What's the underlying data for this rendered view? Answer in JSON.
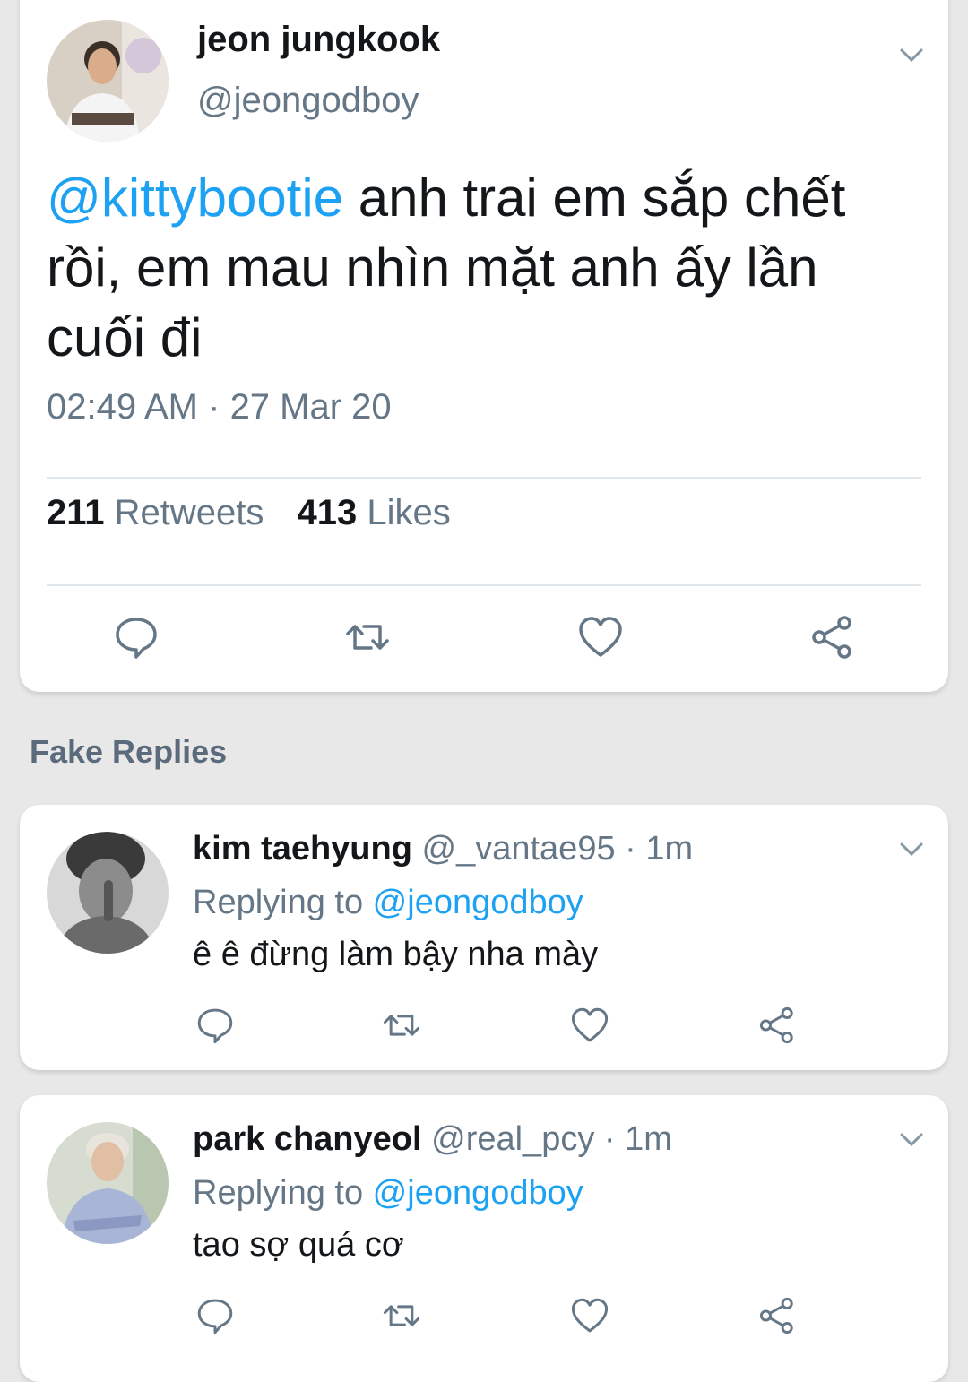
{
  "tweet": {
    "name": "jeon jungkook",
    "handle": "@jeongodboy",
    "mention": "@kittybootie",
    "text": " anh trai em sắp chết rồi, em mau nhìn mặt anh ấy lần cuối đi",
    "time": "02:49 AM",
    "date_separator": " · ",
    "date": "27 Mar 20",
    "retweets_count": "211",
    "retweets_label": " Retweets",
    "likes_count": "413",
    "likes_label": " Likes"
  },
  "section_label": "Fake Replies",
  "replies": [
    {
      "name": "kim taehyung",
      "handle": " @_vantae95",
      "time": " · 1m",
      "replying_prefix": "Replying to ",
      "replying_handle": "@jeongodboy",
      "text": "ê ê đừng làm bậy nha mày"
    },
    {
      "name": "park chanyeol",
      "handle": " @real_pcy",
      "time": " · 1m",
      "replying_prefix": "Replying to ",
      "replying_handle": "@jeongodboy",
      "text": "tao sợ quá cơ"
    }
  ],
  "colors": {
    "accent": "#1da1f2",
    "secondary_text": "#657786",
    "primary_text": "#14171a",
    "background": "#e8e8e8"
  },
  "icons": [
    "reply-icon",
    "retweet-icon",
    "like-icon",
    "share-icon",
    "chevron-down-icon"
  ]
}
